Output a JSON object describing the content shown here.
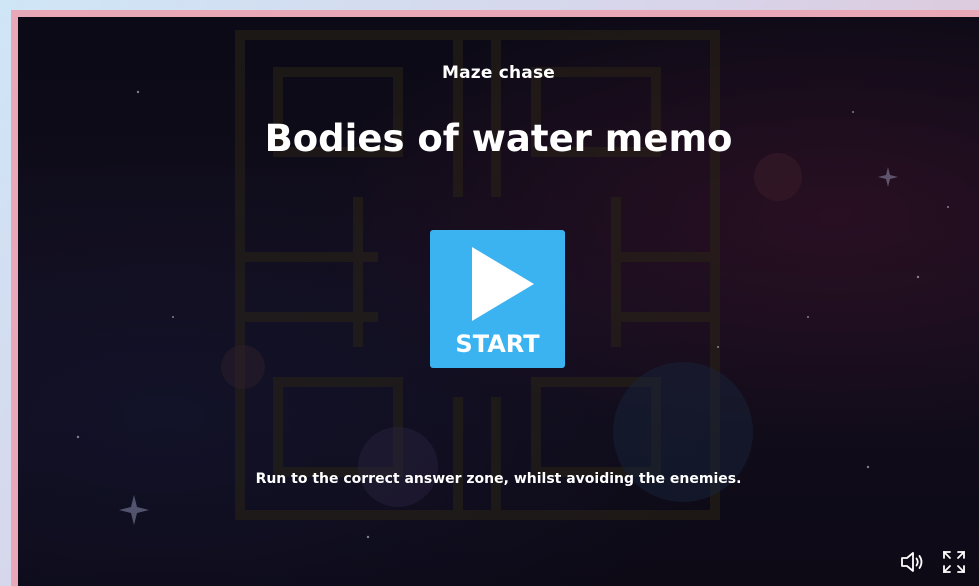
{
  "game": {
    "mode": "Maze chase",
    "title": "Bodies of water memo",
    "start_label": "START",
    "instructions": "Run to the correct answer zone, whilst avoiding the enemies."
  },
  "controls": {
    "sound_icon": "speaker-icon",
    "fullscreen_icon": "fullscreen-icon"
  },
  "colors": {
    "start_button": "#3bb3f0",
    "frame": "#e9a8b8",
    "background": "#0f0c18"
  }
}
